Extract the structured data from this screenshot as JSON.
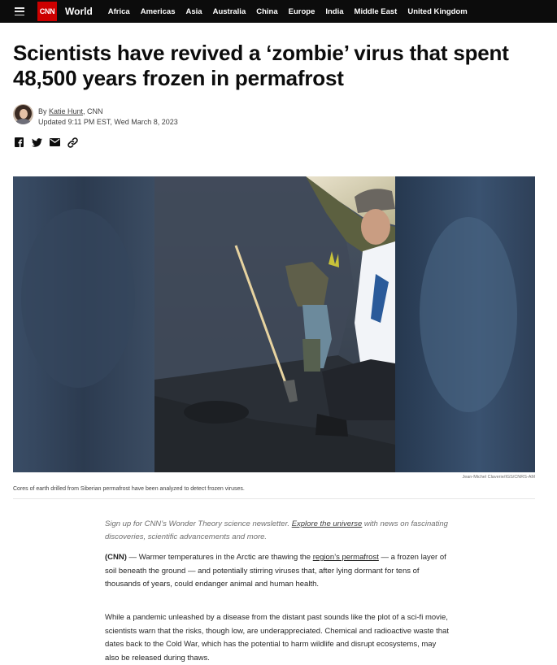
{
  "nav": {
    "logo": "CNN",
    "section": "World",
    "links": [
      "Africa",
      "Americas",
      "Asia",
      "Australia",
      "China",
      "Europe",
      "India",
      "Middle East",
      "United Kingdom"
    ]
  },
  "article": {
    "headline": "Scientists have revived a ‘zombie’ virus that spent 48,500 years frozen in permafrost",
    "byline_prefix": "By ",
    "author": "Katie Hunt",
    "byline_suffix": ", CNN",
    "updated": "Updated 9:11 PM EST, Wed March 8, 2023"
  },
  "share_icons": [
    "facebook-icon",
    "twitter-icon",
    "email-icon",
    "link-icon"
  ],
  "image": {
    "credit": "Jean-Michel Claverie/IGS/CNRS-AM",
    "caption": "Cores of earth drilled from Siberian permafrost have been analyzed to detect frozen viruses."
  },
  "newsletter": {
    "lead": "Sign up for CNN’s Wonder Theory science newsletter. ",
    "link": "Explore the universe",
    "tail": " with news on fascinating discoveries, scientific advancements and more."
  },
  "body": {
    "p1_tag": "(CNN)",
    "p1_a": " — Warmer temperatures in the Arctic are thawing the ",
    "p1_link": "region’s permafrost",
    "p1_b": " — a frozen layer of soil beneath the ground — and potentially stirring viruses that, after lying dormant for tens of thousands of years, could endanger animal and human health.",
    "p2": "While a pandemic unleashed by a disease from the distant past sounds like the plot of a sci-fi movie, scientists warn that the risks, though low, are underappreciated. Chemical and radioactive waste that dates back to the Cold War, which has the potential to harm wildlife and disrupt ecosystems, may also be released during thaws."
  },
  "colors": {
    "brand_red": "#cc0000",
    "nav_bg": "#0c0c0c"
  }
}
